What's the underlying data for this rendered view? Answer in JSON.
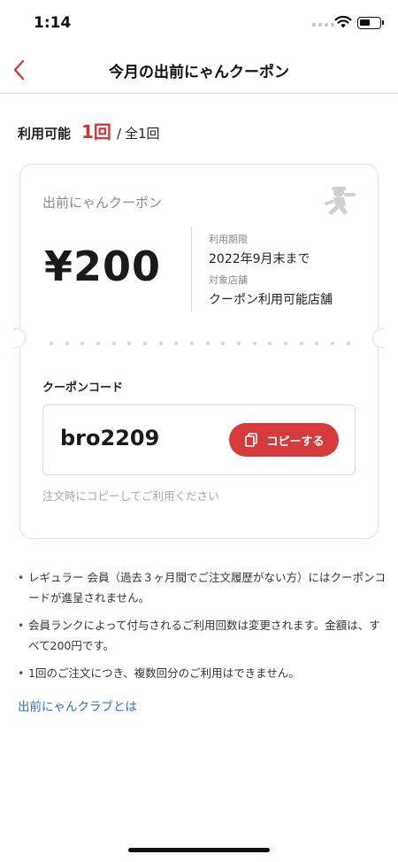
{
  "status_bar": {
    "time": "1:14"
  },
  "nav": {
    "title": "今月の出前にゃんクーポン"
  },
  "usage": {
    "label": "利用可能",
    "count": "1回",
    "slash": "/",
    "total": "全1回"
  },
  "coupon": {
    "title": "出前にゃんクーポン",
    "amount": "¥200",
    "period_label": "利用期限",
    "period_value": "2022年9月末まで",
    "store_label": "対象店舗",
    "store_value": "クーポン利用可能店舗",
    "code_label": "クーポンコード",
    "code": "bro2209",
    "copy_button": "コピーする",
    "hint": "注文時にコピーしてご利用ください"
  },
  "notes": [
    "レギュラー 会員（過去３ヶ月間でご注文履歴がない方）にはクーポンコードが進呈されません。",
    "会員ランクによって付与されるご利用回数は変更されます。金額は、すべて200円です。",
    "1回のご注文につき、複数回分のご利用はできません。"
  ],
  "link": {
    "label": "出前にゃんクラブとは"
  },
  "colors": {
    "accent": "#d63b3b",
    "link": "#2f72c0"
  }
}
